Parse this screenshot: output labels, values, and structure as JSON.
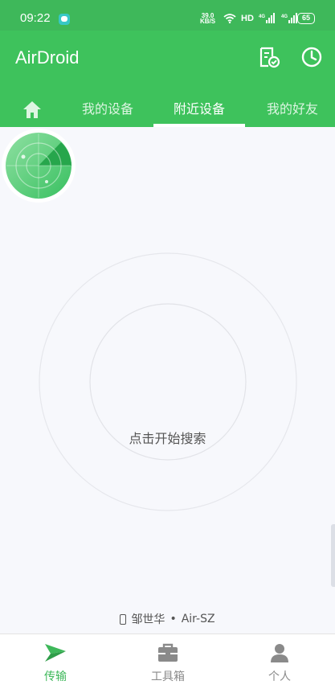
{
  "status_bar": {
    "time": "09:22",
    "net_speed_value": "39.0",
    "net_speed_unit": "KB/S",
    "hd_label": "HD",
    "network_1": "4G",
    "network_2": "4G",
    "battery": "65"
  },
  "app_bar": {
    "title": "AirDroid"
  },
  "tabs": [
    {
      "icon": "home-icon"
    },
    {
      "label": "我的设备"
    },
    {
      "label": "附近设备",
      "selected": true
    },
    {
      "label": "我的好友"
    }
  ],
  "radar": {
    "action_label": "点击开始搜索"
  },
  "device": {
    "name": "邹世华",
    "separator": "•",
    "model": "Air-SZ"
  },
  "bottom_nav": [
    {
      "label": "传输",
      "icon": "send-icon",
      "active": true
    },
    {
      "label": "工具箱",
      "icon": "toolbox-icon"
    },
    {
      "label": "个人",
      "icon": "person-icon"
    }
  ],
  "colors": {
    "primary": "#3EC25C",
    "status_bar": "#3EB85A",
    "background": "#F7F8FC",
    "inactive": "#8A8A8A"
  }
}
